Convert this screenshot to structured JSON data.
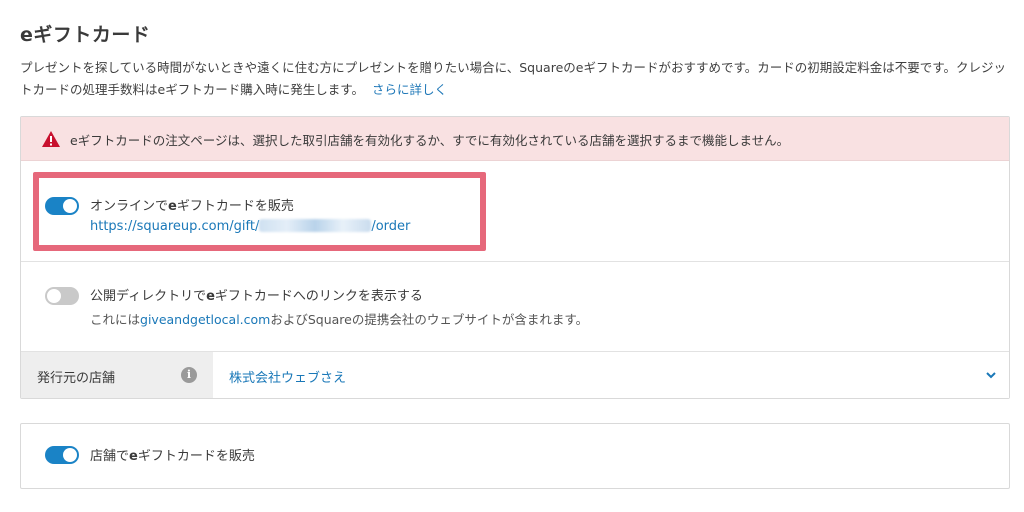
{
  "header": {
    "title_prefix": "e",
    "title_rest": "ギフトカード"
  },
  "description": {
    "text": "プレゼントを探している時間がないときや遠くに住む方にプレゼントを贈りたい場合に、Squareのeギフトカードがおすすめです。カードの初期設定料金は不要です。クレジットカードの処理手数料はeギフトカード購入時に発生します。",
    "link_label": "さらに詳しく"
  },
  "alert": {
    "icon": "warning-icon",
    "message": "eギフトカードの注文ページは、選択した取引店舗を有効化するか、すでに有効化されている店舗を選択するまで機能しません。",
    "color": "#f9e1e2"
  },
  "online_sales": {
    "label_before": "オンラインで",
    "label_bold": "e",
    "label_after": "ギフトカードを販売",
    "toggle_on": true,
    "url_prefix": "https://squareup.com/gift/",
    "url_suffix": "/order"
  },
  "directory": {
    "label_before": "公開ディレクトリで",
    "label_bold": "e",
    "label_after": "ギフトカードへのリンクを表示する",
    "toggle_on": false,
    "sub_before": "これには",
    "sub_link": "giveandgetlocal.com",
    "sub_after": "およびSquareの提携会社のウェブサイトが含まれます。"
  },
  "issuing_store": {
    "label": "発行元の店舗",
    "info_icon": "info-icon",
    "value": "株式会社ウェブさえ",
    "chevron": "chevron-down-icon"
  },
  "in_store": {
    "label_before": "店舗で",
    "label_bold": "e",
    "label_after": "ギフトカードを販売",
    "toggle_on": true
  },
  "colors": {
    "accent": "#1a83c6",
    "link": "#1a78b8",
    "highlight": "#e6687b",
    "warning": "#c8102e"
  }
}
